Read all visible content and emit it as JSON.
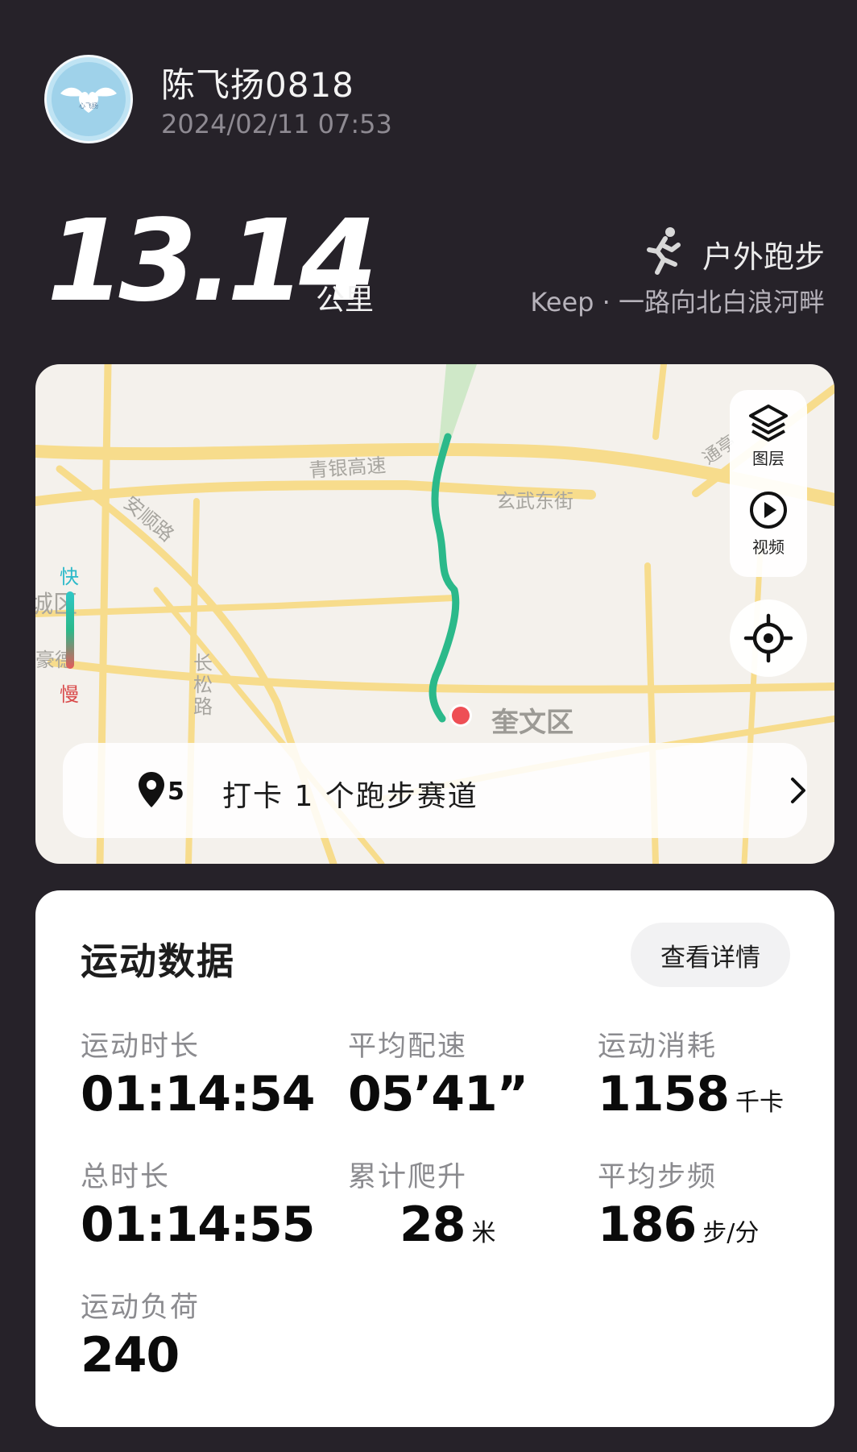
{
  "user": {
    "name": "陈飞扬0818",
    "datetime": "2024/02/11 07:53",
    "avatar_text": "心飞扬"
  },
  "summary": {
    "distance": "13.14",
    "distance_unit": "公里",
    "sport_type": "户外跑步",
    "route": "Keep · 一路向北白浪河畔"
  },
  "map": {
    "road_labels": [
      "青银高速",
      "玄武东街",
      "安顺路",
      "长松路",
      "通亭",
      "豪德",
      "城区"
    ],
    "district": "奎文区",
    "layers_label": "图层",
    "video_label": "视频",
    "speed_fast": "快",
    "speed_slow": "慢",
    "checkin_text": "打卡 1 个跑步赛道",
    "route_color": "#2bb98a",
    "road_color": "#f7dc8c"
  },
  "stats": {
    "title": "运动数据",
    "detail_button": "查看详情",
    "items": [
      {
        "label": "运动时长",
        "value": "01:14:54",
        "unit": ""
      },
      {
        "label": "平均配速",
        "value": "05’41”",
        "unit": ""
      },
      {
        "label": "运动消耗",
        "value": "1158",
        "unit": "千卡"
      },
      {
        "label": "总时长",
        "value": "01:14:55",
        "unit": ""
      },
      {
        "label": "累计爬升",
        "value": "28",
        "unit": "米"
      },
      {
        "label": "平均步频",
        "value": "186",
        "unit": "步/分"
      },
      {
        "label": "运动负荷",
        "value": "240",
        "unit": ""
      }
    ]
  }
}
